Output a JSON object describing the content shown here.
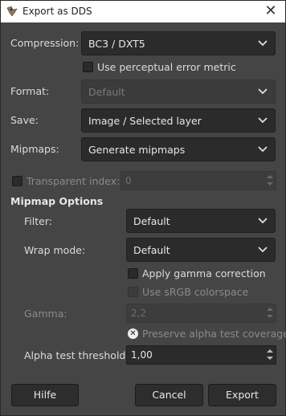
{
  "window": {
    "title": "Export as DDS",
    "close_glyph": "✕",
    "app_icon": "gimp-icon"
  },
  "compression": {
    "label": "Compression:",
    "value": "BC3 / DXT5"
  },
  "perceptual": {
    "label": "Use perceptual error metric",
    "checked": false
  },
  "format": {
    "label": "Format:",
    "value": "Default",
    "enabled": false
  },
  "save": {
    "label": "Save:",
    "value": "Image / Selected layer"
  },
  "mipmaps": {
    "label": "Mipmaps:",
    "value": "Generate mipmaps"
  },
  "transparent_index": {
    "label": "Transparent index:",
    "value": "0",
    "checked": false,
    "enabled": false
  },
  "mipmap_options": {
    "heading": "Mipmap Options",
    "filter": {
      "label": "Filter:",
      "value": "Default"
    },
    "wrap_mode": {
      "label": "Wrap mode:",
      "value": "Default"
    },
    "gamma_correction": {
      "label": "Apply gamma correction",
      "checked": false
    },
    "srgb": {
      "label": "Use sRGB colorspace",
      "checked": false,
      "enabled": false
    },
    "gamma": {
      "label": "Gamma:",
      "value": "2,2",
      "enabled": false
    },
    "preserve_alpha": {
      "label": "Preserve alpha test coverage",
      "checked": true,
      "enabled": false
    },
    "alpha_threshold": {
      "label": "Alpha test threshold:",
      "value": "1,00"
    }
  },
  "buttons": {
    "help": "Hilfe",
    "cancel": "Cancel",
    "export": "Export"
  },
  "colors": {
    "background": "#454545",
    "field": "#2b2b2b",
    "titlebar": "#ffffff"
  }
}
